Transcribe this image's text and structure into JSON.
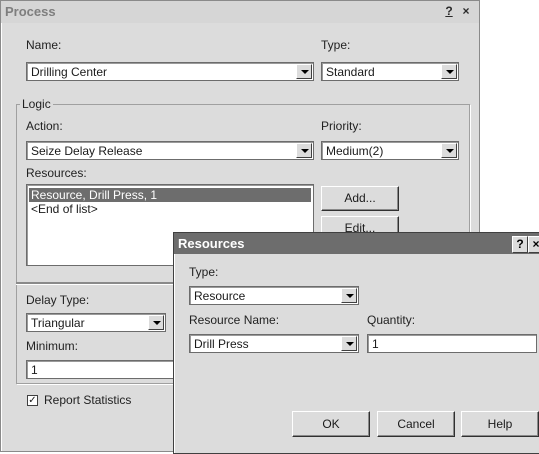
{
  "process": {
    "title": "Process",
    "help_label": "?",
    "close_label": "×",
    "name_label": "Name:",
    "name_value": "Drilling Center",
    "type_label": "Type:",
    "type_value": "Standard",
    "logic_label": "Logic",
    "action_label": "Action:",
    "action_value": "Seize Delay Release",
    "priority_label": "Priority:",
    "priority_value": "Medium(2)",
    "resources_label": "Resources:",
    "resources_items": [
      "Resource, Drill Press, 1",
      "<End of list>"
    ],
    "add_label": "Add...",
    "edit_label": "Edit...",
    "delay_type_label": "Delay Type:",
    "delay_type_value": "Triangular",
    "minimum_label": "Minimum:",
    "minimum_value": "1",
    "report_stats_label": "Report Statistics",
    "report_stats_checked": true
  },
  "resources_dialog": {
    "title": "Resources",
    "help_label": "?",
    "close_label": "×",
    "type_label": "Type:",
    "type_value": "Resource",
    "resource_name_label": "Resource Name:",
    "resource_name_value": "Drill Press",
    "quantity_label": "Quantity:",
    "quantity_value": "1",
    "ok_label": "OK",
    "cancel_label": "Cancel",
    "help_button_label": "Help"
  }
}
